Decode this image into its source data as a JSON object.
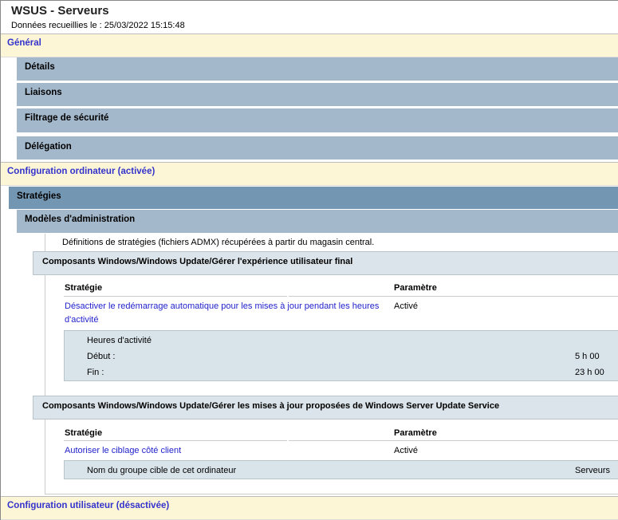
{
  "header": {
    "title": "WSUS - Serveurs",
    "collected": "Données recueillies le : 25/03/2022 15:15:48"
  },
  "general": {
    "label": "Général",
    "items": [
      "Détails",
      "Liaisons",
      "Filtrage de sécurité",
      "Délégation"
    ]
  },
  "computer": {
    "label": "Configuration ordinateur (activée)",
    "policies": "Stratégies",
    "admin_templates": "Modèles d'administration",
    "admx_note": "Définitions de stratégies (fichiers ADMX) récupérées à partir du magasin central.",
    "sections": [
      {
        "title": "Composants Windows/Windows Update/Gérer l'expérience utilisateur final",
        "col_policy": "Stratégie",
        "col_setting": "Paramètre",
        "policy": "Désactiver le redémarrage automatique pour les mises à jour pendant les heures",
        "policy_cont": "d'activité",
        "setting": "Activé",
        "detail_title": "Heures d'activité",
        "start_label": "Début :",
        "start_value": "5 h 00",
        "end_label": "Fin :",
        "end_value": "23 h 00"
      },
      {
        "title": "Composants Windows/Windows Update/Gérer les mises à jour proposées de Windows Server Update Service",
        "col_policy": "Stratégie",
        "col_setting": "Paramètre",
        "policy": "Autoriser le ciblage côté client",
        "setting": "Activé",
        "detail_label": "Nom du groupe cible de cet ordinateur",
        "detail_value": "Serveurs"
      }
    ]
  },
  "user": {
    "label": "Configuration utilisateur (désactivée)"
  }
}
